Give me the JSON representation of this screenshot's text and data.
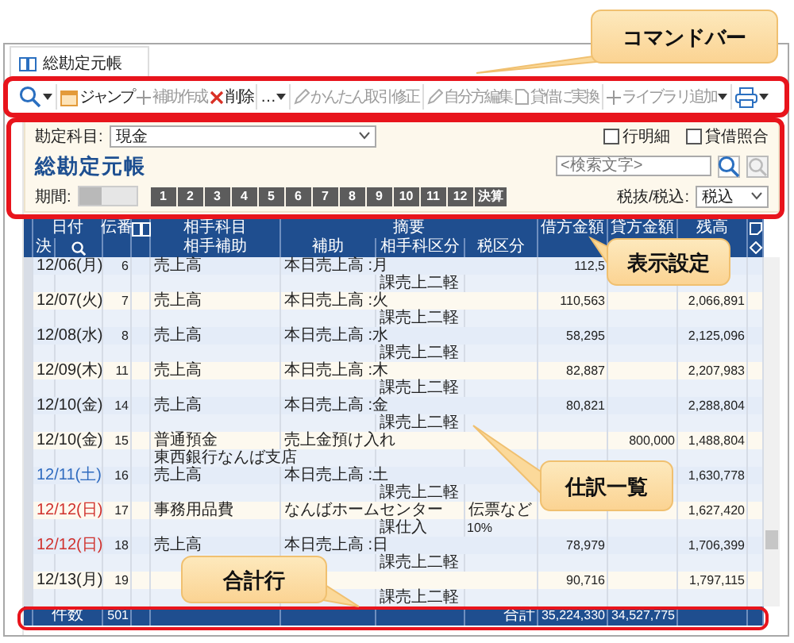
{
  "window": {
    "tab": "総勘定元帳"
  },
  "toolbar": [
    {
      "kind": "search"
    },
    {
      "kind": "button",
      "label": "ジャンプ",
      "disabled": false
    },
    {
      "kind": "button",
      "label": "補助作成",
      "disabled": true
    },
    {
      "kind": "button",
      "label": "削除",
      "disabled": false
    },
    {
      "kind": "menu",
      "label": "…",
      "disabled": false
    },
    {
      "kind": "button",
      "label": "かんたん取引修正",
      "disabled": true
    },
    {
      "kind": "button",
      "label": "自分方編集",
      "disabled": true
    },
    {
      "kind": "button",
      "label": "貸借に実換",
      "disabled": true
    },
    {
      "kind": "menu",
      "label": "ライブラリ追加",
      "disabled": true
    },
    {
      "kind": "print"
    }
  ],
  "settings": {
    "account_label": "勘定科目:",
    "account": "現金",
    "options": [
      {
        "label": "行明細",
        "checked": false
      },
      {
        "label": "貸借照合",
        "checked": false
      }
    ],
    "title": "総勘定元帳",
    "search": {
      "placeholder": "<検索文字>"
    },
    "period_label": "期間:",
    "period_slider": {
      "level": 0.4
    },
    "months": [
      {
        "label": "1",
        "selected": true
      },
      {
        "label": "2",
        "selected": true
      },
      {
        "label": "3",
        "selected": true
      },
      {
        "label": "4",
        "selected": true
      },
      {
        "label": "5",
        "selected": true
      },
      {
        "label": "6",
        "selected": true
      },
      {
        "label": "7",
        "selected": true
      },
      {
        "label": "8",
        "selected": true
      },
      {
        "label": "9",
        "selected": true
      },
      {
        "label": "10",
        "selected": true
      },
      {
        "label": "11",
        "selected": true
      },
      {
        "label": "12",
        "selected": true
      },
      {
        "label": "決算",
        "selected": true
      }
    ],
    "tax_label": "税抜/税込:",
    "tax": "税込"
  },
  "table": {
    "header": {
      "date": "日付",
      "no": "伝番",
      "account": "相手科目",
      "summary": "摘要",
      "debit": "借方金額",
      "credit": "貸方金額",
      "balance": "残高",
      "settled": "決",
      "sub_account": "相手補助",
      "aux": "補助",
      "partner_class": "相手科区分",
      "tax": "税区分"
    },
    "rows": [
      {
        "date": "12/06(月)",
        "color": "#222222",
        "no": "6",
        "account": "売上高",
        "summary": "本日売上高 :月",
        "debit": "112,5",
        "tax": "課売上二軽"
      },
      {
        "date": "12/07(火)",
        "color": "#222222",
        "no": "7",
        "account": "売上高",
        "summary": "本日売上高 :火",
        "debit": "110,563",
        "balance": "2,066,891",
        "tax": "課売上二軽"
      },
      {
        "date": "12/08(水)",
        "color": "#222222",
        "no": "8",
        "account": "売上高",
        "summary": "本日売上高 :水",
        "debit": "58,295",
        "balance": "2,125,096",
        "tax": "課売上二軽"
      },
      {
        "date": "12/09(木)",
        "color": "#222222",
        "no": "11",
        "account": "売上高",
        "summary": "本日売上高 :木",
        "debit": "82,887",
        "balance": "2,207,983",
        "tax": "課売上二軽"
      },
      {
        "date": "12/10(金)",
        "color": "#222222",
        "no": "14",
        "account": "売上高",
        "summary": "本日売上高 :金",
        "debit": "80,821",
        "balance": "2,288,804",
        "tax": "課売上二軽"
      },
      {
        "date": "12/10(金)",
        "color": "#222222",
        "no": "15",
        "account": "普通預金",
        "summary": "売上金預け入れ",
        "credit": "800,000",
        "balance": "1,488,804",
        "sub_account": "東西銀行なんば支店"
      },
      {
        "date": "12/11(土)",
        "color": "#2f6bbf",
        "no": "16",
        "account": "売上高",
        "summary": "本日売上高 :土",
        "balance": "1,630,778",
        "tax": "課売上二軽"
      },
      {
        "date": "12/12(日)",
        "color": "#d0312d",
        "no": "17",
        "account": "事務用品費",
        "aux": "なんばホームセンター",
        "summary": "伝票など",
        "balance": "1,627,420",
        "tax": "課仕入",
        "tax_rate": "10%"
      },
      {
        "date": "12/12(日)",
        "color": "#d0312d",
        "no": "18",
        "account": "売上高",
        "summary": "本日売上高 :日",
        "debit": "78,979",
        "balance": "1,706,399",
        "tax": "課売上二軽"
      },
      {
        "date": "12/13(月)",
        "color": "#222222",
        "no": "19",
        "debit": "90,716",
        "balance": "1,797,115",
        "tax": "課売上二軽"
      }
    ],
    "total": {
      "count_label": "件数",
      "count": "501",
      "label": "合計",
      "debit": "35,224,330",
      "credit": "34,527,775"
    }
  },
  "callouts": [
    {
      "label": "コマンドバー"
    },
    {
      "label": "表示設定"
    },
    {
      "label": "仕訳一覧"
    },
    {
      "label": "合計行"
    }
  ]
}
